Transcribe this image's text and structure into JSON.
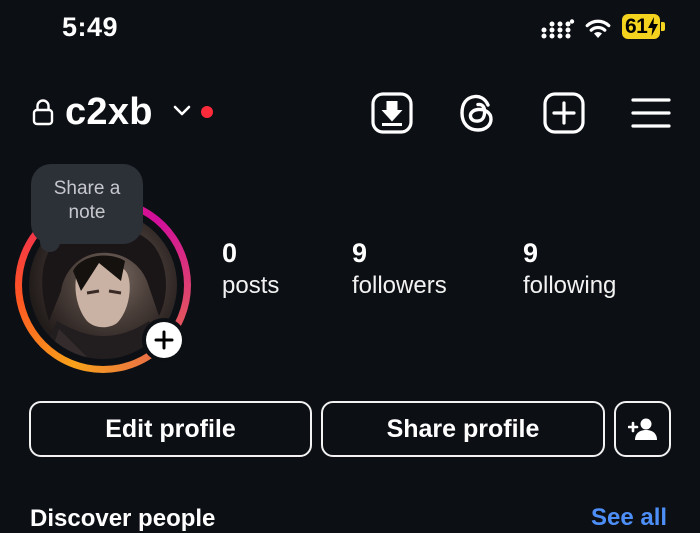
{
  "status_bar": {
    "time": "5:49",
    "battery": "61"
  },
  "header": {
    "username": "c2xb"
  },
  "note": {
    "line1": "Share a",
    "line2": "note"
  },
  "stats": [
    {
      "value": "0",
      "label": "posts"
    },
    {
      "value": "9",
      "label": "followers"
    },
    {
      "value": "9",
      "label": "following"
    }
  ],
  "buttons": {
    "edit_profile": "Edit profile",
    "share_profile": "Share profile"
  },
  "discover": {
    "title": "Discover people",
    "see_all": "See all"
  },
  "colors": {
    "background": "#0c0f14",
    "notification_dot": "#ff2b3a",
    "link": "#4d8ef7",
    "battery": "#f3d31e"
  },
  "icons": [
    "lock-icon",
    "chevron-down-icon",
    "download-icon",
    "threads-icon",
    "create-icon",
    "menu-icon",
    "add-person-icon",
    "plus-icon"
  ]
}
